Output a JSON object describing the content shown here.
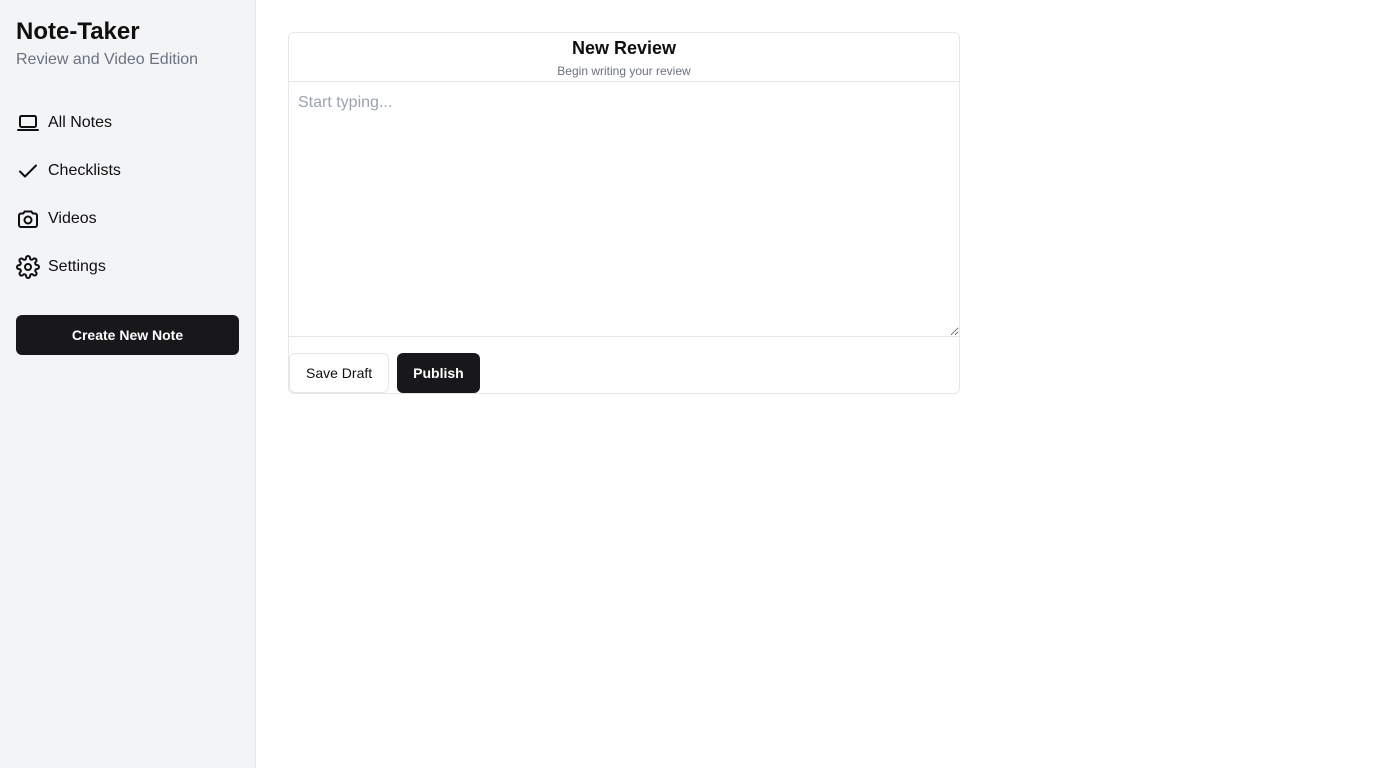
{
  "sidebar": {
    "title": "Note-Taker",
    "subtitle": "Review and Video Edition",
    "nav": [
      {
        "label": "All Notes",
        "icon": "laptop-icon"
      },
      {
        "label": "Checklists",
        "icon": "check-icon"
      },
      {
        "label": "Videos",
        "icon": "camera-icon"
      },
      {
        "label": "Settings",
        "icon": "gear-icon"
      }
    ],
    "create_label": "Create New Note"
  },
  "editor": {
    "title": "New Review",
    "subtitle": "Begin writing your review",
    "placeholder": "Start typing...",
    "value": "",
    "save_label": "Save Draft",
    "publish_label": "Publish"
  },
  "colors": {
    "sidebar_bg": "#f3f4f6",
    "primary": "#18181b",
    "muted_text": "#6b7280",
    "border": "#e5e7eb"
  }
}
